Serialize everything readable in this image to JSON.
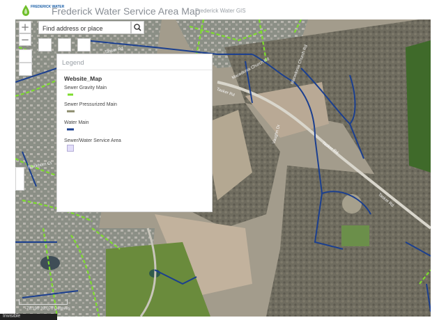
{
  "header": {
    "logo_text": "FREDERICK WATER",
    "title": "Frederick Water Service Area Map",
    "subtitle": "Frederick Water GIS"
  },
  "search": {
    "placeholder": "Find address or place"
  },
  "zoom": {
    "in_label": "+",
    "out_label": "−"
  },
  "legend": {
    "title": "Legend",
    "layer_name": "Website_Map",
    "items": [
      {
        "label": "Sewer Gravity Main",
        "color": "#7ddc2e"
      },
      {
        "label": "Sewer Pressurized Main",
        "color": "#8c8c6e"
      },
      {
        "label": "Water Main",
        "color": "#1b3f8f"
      },
      {
        "label": "Sewer/Water Service Area",
        "color": "#e3defa"
      }
    ]
  },
  "map": {
    "road_labels": [
      "Tasker Rd",
      "Macedonia Church Rd",
      "Tasker Rd",
      "Macedonia Church Rd",
      "Tasker Rd",
      "Vaughn Dr",
      "Blackburn Ct",
      "Tasker Rd"
    ],
    "attribution": "-78.190 39.070 Degrees",
    "bottom_text": "Invisible"
  },
  "colors": {
    "sewer_gravity": "#7ddc2e",
    "water_main": "#1b3f8f",
    "aerial_base": "#9a9484"
  }
}
